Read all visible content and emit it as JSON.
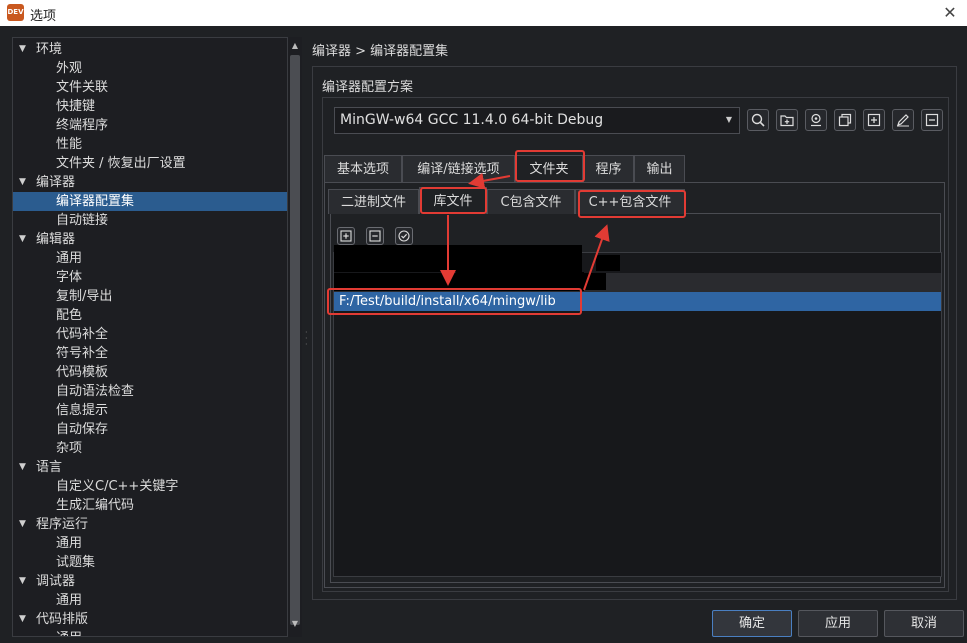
{
  "window": {
    "title": "选项",
    "app_icon_text": "DEV"
  },
  "tree": {
    "items": [
      {
        "label": "环境",
        "level": 0,
        "expanded": true
      },
      {
        "label": "外观",
        "level": 1
      },
      {
        "label": "文件关联",
        "level": 1
      },
      {
        "label": "快捷键",
        "level": 1
      },
      {
        "label": "终端程序",
        "level": 1
      },
      {
        "label": "性能",
        "level": 1
      },
      {
        "label": "文件夹 / 恢复出厂设置",
        "level": 1
      },
      {
        "label": "编译器",
        "level": 0,
        "expanded": true
      },
      {
        "label": "编译器配置集",
        "level": 1,
        "selected": true
      },
      {
        "label": "自动链接",
        "level": 1
      },
      {
        "label": "编辑器",
        "level": 0,
        "expanded": true
      },
      {
        "label": "通用",
        "level": 1
      },
      {
        "label": "字体",
        "level": 1
      },
      {
        "label": "复制/导出",
        "level": 1
      },
      {
        "label": "配色",
        "level": 1
      },
      {
        "label": "代码补全",
        "level": 1
      },
      {
        "label": "符号补全",
        "level": 1
      },
      {
        "label": "代码模板",
        "level": 1
      },
      {
        "label": "自动语法检查",
        "level": 1
      },
      {
        "label": "信息提示",
        "level": 1
      },
      {
        "label": "自动保存",
        "level": 1
      },
      {
        "label": "杂项",
        "level": 1
      },
      {
        "label": "语言",
        "level": 0,
        "expanded": true
      },
      {
        "label": "自定义C/C++关键字",
        "level": 1
      },
      {
        "label": "生成汇编代码",
        "level": 1
      },
      {
        "label": "程序运行",
        "level": 0,
        "expanded": true
      },
      {
        "label": "通用",
        "level": 1
      },
      {
        "label": "试题集",
        "level": 1
      },
      {
        "label": "调试器",
        "level": 0,
        "expanded": true
      },
      {
        "label": "通用",
        "level": 1
      },
      {
        "label": "代码排版",
        "level": 0,
        "expanded": true
      },
      {
        "label": "通用",
        "level": 1
      }
    ]
  },
  "breadcrumb": "编译器 > 编译器配置集",
  "profile": {
    "group_title": "编译器配置方案",
    "selected": "MinGW-w64 GCC 11.4.0 64-bit Debug"
  },
  "tabs": [
    "基本选项",
    "编译/链接选项",
    "文件夹",
    "程序",
    "输出"
  ],
  "subtabs": [
    "二进制文件",
    "库文件",
    "C包含文件",
    "C++包含文件"
  ],
  "lib_dirs": [
    "",
    "",
    "F:/Test/build/install/x64/mingw/lib"
  ],
  "buttons": {
    "ok": "确定",
    "apply": "应用",
    "cancel": "取消"
  },
  "colors": {
    "annotation": "#e23b34",
    "selection": "#2f65a3"
  }
}
